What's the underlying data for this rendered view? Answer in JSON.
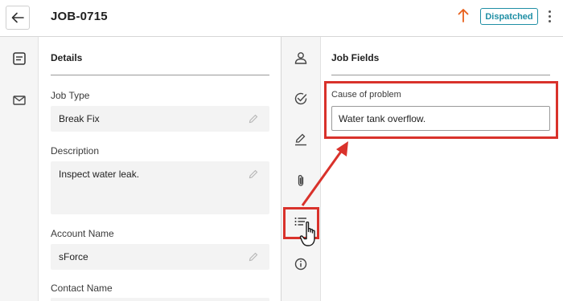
{
  "header": {
    "job_id": "JOB-0715",
    "status": "Dispatched",
    "priority_icon": "arrow-up-icon",
    "accent_color": "#e8601c",
    "status_color": "#1f8fa5"
  },
  "left_rail": {
    "items": [
      {
        "icon": "details-icon"
      },
      {
        "icon": "mail-icon"
      }
    ]
  },
  "details": {
    "title": "Details",
    "fields": [
      {
        "label": "Job Type",
        "value": "Break Fix"
      },
      {
        "label": "Description",
        "value": "Inspect water leak."
      },
      {
        "label": "Account Name",
        "value": "sForce"
      },
      {
        "label": "Contact Name",
        "value": ""
      }
    ]
  },
  "mid_rail": {
    "items": [
      {
        "icon": "person-icon"
      },
      {
        "icon": "check-circle-icon"
      },
      {
        "icon": "pen-icon"
      },
      {
        "icon": "paperclip-icon"
      },
      {
        "icon": "list-icon",
        "active": true
      },
      {
        "icon": "info-icon"
      }
    ]
  },
  "job_fields": {
    "title": "Job Fields",
    "cause_label": "Cause of problem",
    "cause_value": "Water tank overflow."
  },
  "annotation_color": "#d9322b"
}
